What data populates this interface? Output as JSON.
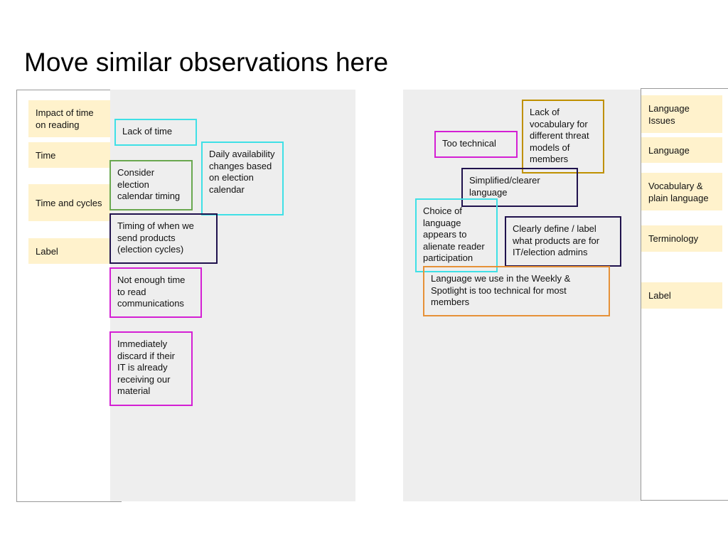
{
  "board": {
    "title": "Move similar observations here"
  },
  "colors": {
    "label_fill": "#fff2cc",
    "canvas_gray": "#eeeeee",
    "cyan": "#3fe0e6",
    "green": "#6aa84f",
    "navy": "#20124d",
    "magenta": "#d41fd4",
    "gold": "#bf9000",
    "orange": "#e69138"
  },
  "left_cluster": {
    "labels": [
      "Impact of time on reading",
      "Time",
      "Time and cycles",
      "Label"
    ],
    "notes": [
      {
        "text": "Lack of time",
        "color": "cyan"
      },
      {
        "text": "Daily availability changes based on election calendar",
        "color": "cyan"
      },
      {
        "text": "Consider election calendar timing",
        "color": "green"
      },
      {
        "text": "Timing of when we send products (election cycles)",
        "color": "navy"
      },
      {
        "text": "Not enough time to read communications",
        "color": "magenta"
      },
      {
        "text": "Immediately discard if their IT is already receiving our material",
        "color": "magenta"
      }
    ]
  },
  "right_cluster": {
    "labels": [
      "Language Issues",
      "Language",
      "Vocabulary & plain language",
      "Terminology",
      "Label"
    ],
    "notes": [
      {
        "text": "Too technical",
        "color": "magenta"
      },
      {
        "text": "Lack of vocabulary for different threat models of members",
        "color": "gold"
      },
      {
        "text": "Simplified/clearer language",
        "color": "navy"
      },
      {
        "text": "Choice of language appears to alienate reader participation",
        "color": "cyan"
      },
      {
        "text": "Clearly define / label what products are for IT/election admins",
        "color": "navy"
      },
      {
        "text": "Language we use in the Weekly & Spotlight is too technical for most members",
        "color": "orange"
      }
    ]
  }
}
